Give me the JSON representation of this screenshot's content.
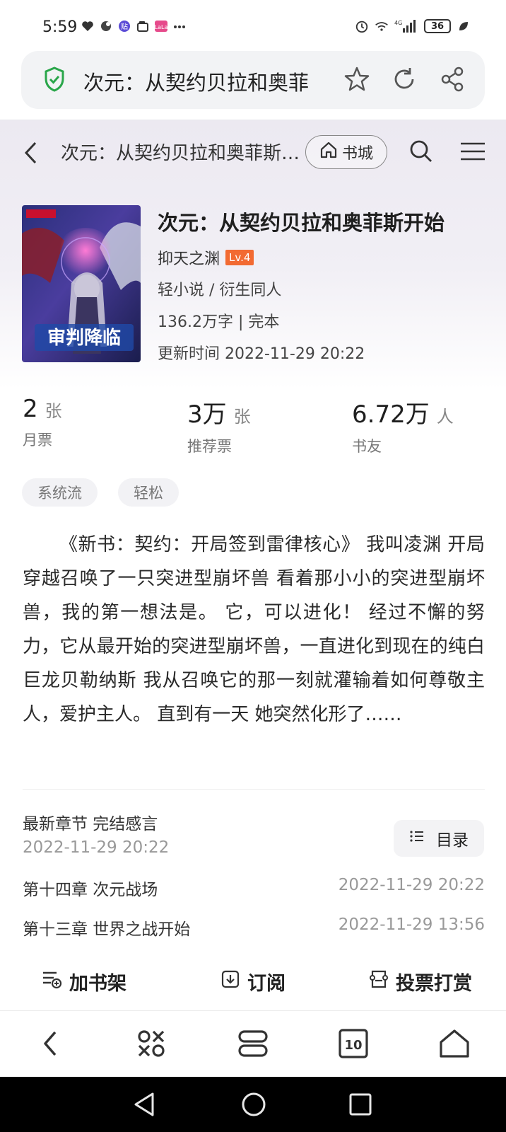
{
  "status_bar": {
    "time": "5:59",
    "battery": "36",
    "network": "4G"
  },
  "browser": {
    "url_title": "次元：从契约贝拉和奥菲",
    "tabs_count": "10"
  },
  "page_nav": {
    "title": "次元：从契约贝拉和奥菲斯开始",
    "shop_label": "书城"
  },
  "book": {
    "title": "次元：从契约贝拉和奥菲斯开始",
    "author": "抑天之渊",
    "level": "Lv.4",
    "category": "轻小说 / 衍生同人",
    "wordcount": "136.2万字 | 完本",
    "update": "更新时间 2022-11-29 20:22",
    "cover_text": "审判降临"
  },
  "stats": [
    {
      "value": "2",
      "unit": "张",
      "label": "月票"
    },
    {
      "value": "3万",
      "unit": "张",
      "label": "推荐票"
    },
    {
      "value": "6.72万",
      "unit": "人",
      "label": "书友"
    }
  ],
  "tags": [
    "系统流",
    "轻松"
  ],
  "synopsis": "《新书：契约：开局签到雷律核心》 我叫凌渊 开局穿越召唤了一只突进型崩坏兽 看着那小小的突进型崩坏兽，我的第一想法是。 它，可以进化！ 经过不懈的努力，它从最开始的突进型崩坏兽，一直进化到现在的纯白巨龙贝勒纳斯 我从召唤它的那一刻就灌输着如何尊敬主人，爱护主人。 直到有一天 她突然化形了……",
  "chapters": {
    "latest_label": "最新章节 完结感言",
    "latest_date": "2022-11-29 20:22",
    "toc_label": "目录",
    "list": [
      {
        "title": "第十四章 次元战场",
        "date": "2022-11-29 20:22"
      },
      {
        "title": "第十三章 世界之战开始",
        "date": "2022-11-29 13:56"
      }
    ]
  },
  "actions": {
    "bookshelf": "加书架",
    "subscribe": "订阅",
    "vote": "投票打赏"
  },
  "colors": {
    "accent_green": "#2aa64a",
    "level_badge": "#f26a32"
  }
}
